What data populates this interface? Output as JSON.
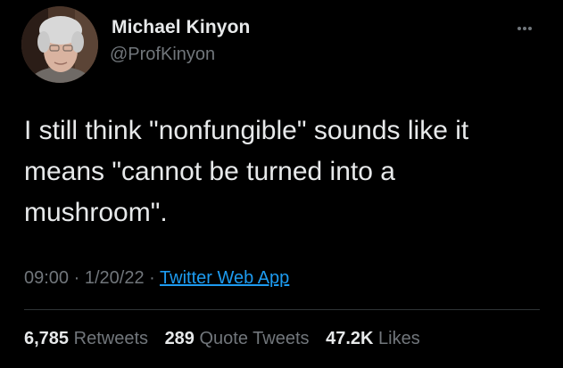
{
  "author": {
    "name": "Michael Kinyon",
    "handle": "@ProfKinyon"
  },
  "tweet": {
    "lines": [
      "I still think \"nonfungible\" sounds like it",
      "means \"cannot be turned into a",
      "mushroom\"."
    ]
  },
  "meta": {
    "time": "09:00",
    "separator": "·",
    "date": "1/20/22",
    "source": "Twitter Web App"
  },
  "stats": {
    "retweets": {
      "count": "6,785",
      "label": "Retweets"
    },
    "quote_tweets": {
      "count": "289",
      "label": "Quote Tweets"
    },
    "likes": {
      "count": "47.2K",
      "label": "Likes"
    }
  },
  "colors": {
    "background": "#000000",
    "primary_text": "#e7e9ea",
    "secondary_text": "#71767b",
    "link": "#1d9bf0",
    "divider": "#2f3336"
  },
  "icons": {
    "more": "more-options-icon"
  }
}
